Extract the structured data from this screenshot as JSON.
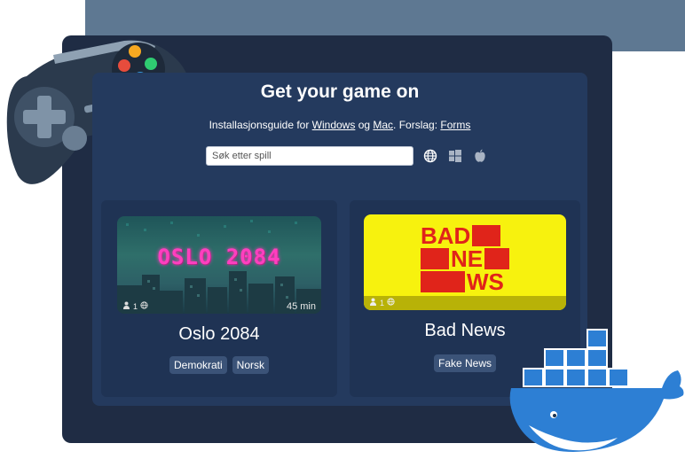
{
  "colors": {
    "panel": "#243a5e",
    "card": "#1f3354",
    "tag": "#3b5378",
    "accent_pink": "#ff3fbf",
    "bad_news_yellow": "#f7f20e",
    "bad_news_red": "#e0241a",
    "docker_blue": "#2d7fd4"
  },
  "header": {
    "title": "Get your game on",
    "guide_prefix": "Installasjonsguide for ",
    "windows_link": "Windows",
    "og": " og ",
    "mac_link": "Mac",
    "suggest_prefix": ". Forslag: ",
    "forms_link": "Forms"
  },
  "search": {
    "placeholder": "Søk etter spill",
    "value": ""
  },
  "filters": {
    "icons": [
      "globe-icon",
      "windows-icon",
      "apple-icon"
    ]
  },
  "games": [
    {
      "title": "Oslo 2084",
      "thumbnail_text": "OSLO 2084",
      "players": "1",
      "duration": "45 min",
      "tags": [
        "Demokrati",
        "Norsk"
      ]
    },
    {
      "title": "Bad News",
      "thumbnail_lines": [
        "BAD",
        "NE",
        "WS"
      ],
      "players": "1",
      "tags": [
        "Fake News"
      ]
    }
  ],
  "decorations": [
    "gamepad-icon",
    "docker-whale-icon"
  ]
}
